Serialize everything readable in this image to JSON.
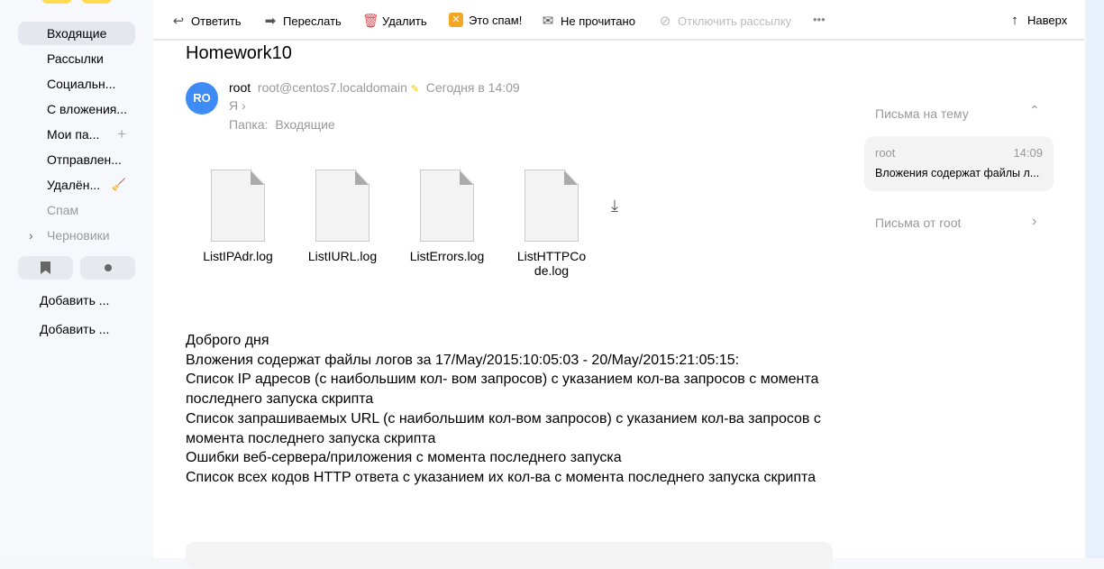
{
  "sidebar": {
    "folders": [
      {
        "label": "Входящие"
      },
      {
        "label": "Рассылки"
      },
      {
        "label": "Социальн..."
      },
      {
        "label": "С вложения..."
      },
      {
        "label": "Мои па..."
      },
      {
        "label": "Отправлен..."
      },
      {
        "label": "Удалён..."
      },
      {
        "label": "Спам"
      },
      {
        "label": "Черновики"
      }
    ],
    "add_labels": [
      "Добавить ...",
      "Добавить ..."
    ]
  },
  "toolbar": {
    "reply": "Ответить",
    "forward": "Переслать",
    "delete": "Удалить",
    "spam": "Это спам!",
    "unread": "Не прочитано",
    "unsubscribe": "Отключить рассылку",
    "more": "•••",
    "top": "Наверх"
  },
  "message": {
    "subject": "Homework10",
    "avatar": "RO",
    "sender": "root",
    "email": "root@centos7.localdomain",
    "date": "Сегодня в 14:09",
    "to": "Я",
    "folder_label": "Папка:",
    "folder": "Входящие",
    "attachments": [
      "ListIPAdr.log",
      "ListIURL.log",
      "ListErrors.log",
      "ListHTTPCode.log"
    ],
    "body": [
      "Доброго дня",
      "Вложения содержат файлы логов за 17/May/2015:10:05:03 - 20/May/2015:21:05:15:",
      "Список IP адресов (с наибольшим кол- вом запросов) с указанием кол-ва запросов с момента последнего запуска скрипта",
      "Список запрашиваемых URL (с наибольшим кол-вом запросов) с указанием кол-ва запросов с момента последнего запуска скрипта",
      "Ошибки веб-сервера/приложения с момента последнего запуска",
      "Список всех кодов HTTP ответа с указанием их кол-ва с момента последнего запуска скрипта"
    ]
  },
  "right": {
    "thread_title": "Письма на тему",
    "thread_item": {
      "from": "root",
      "time": "14:09",
      "snippet": "Вложения содержат файлы л..."
    },
    "from_title": "Письма от root"
  }
}
